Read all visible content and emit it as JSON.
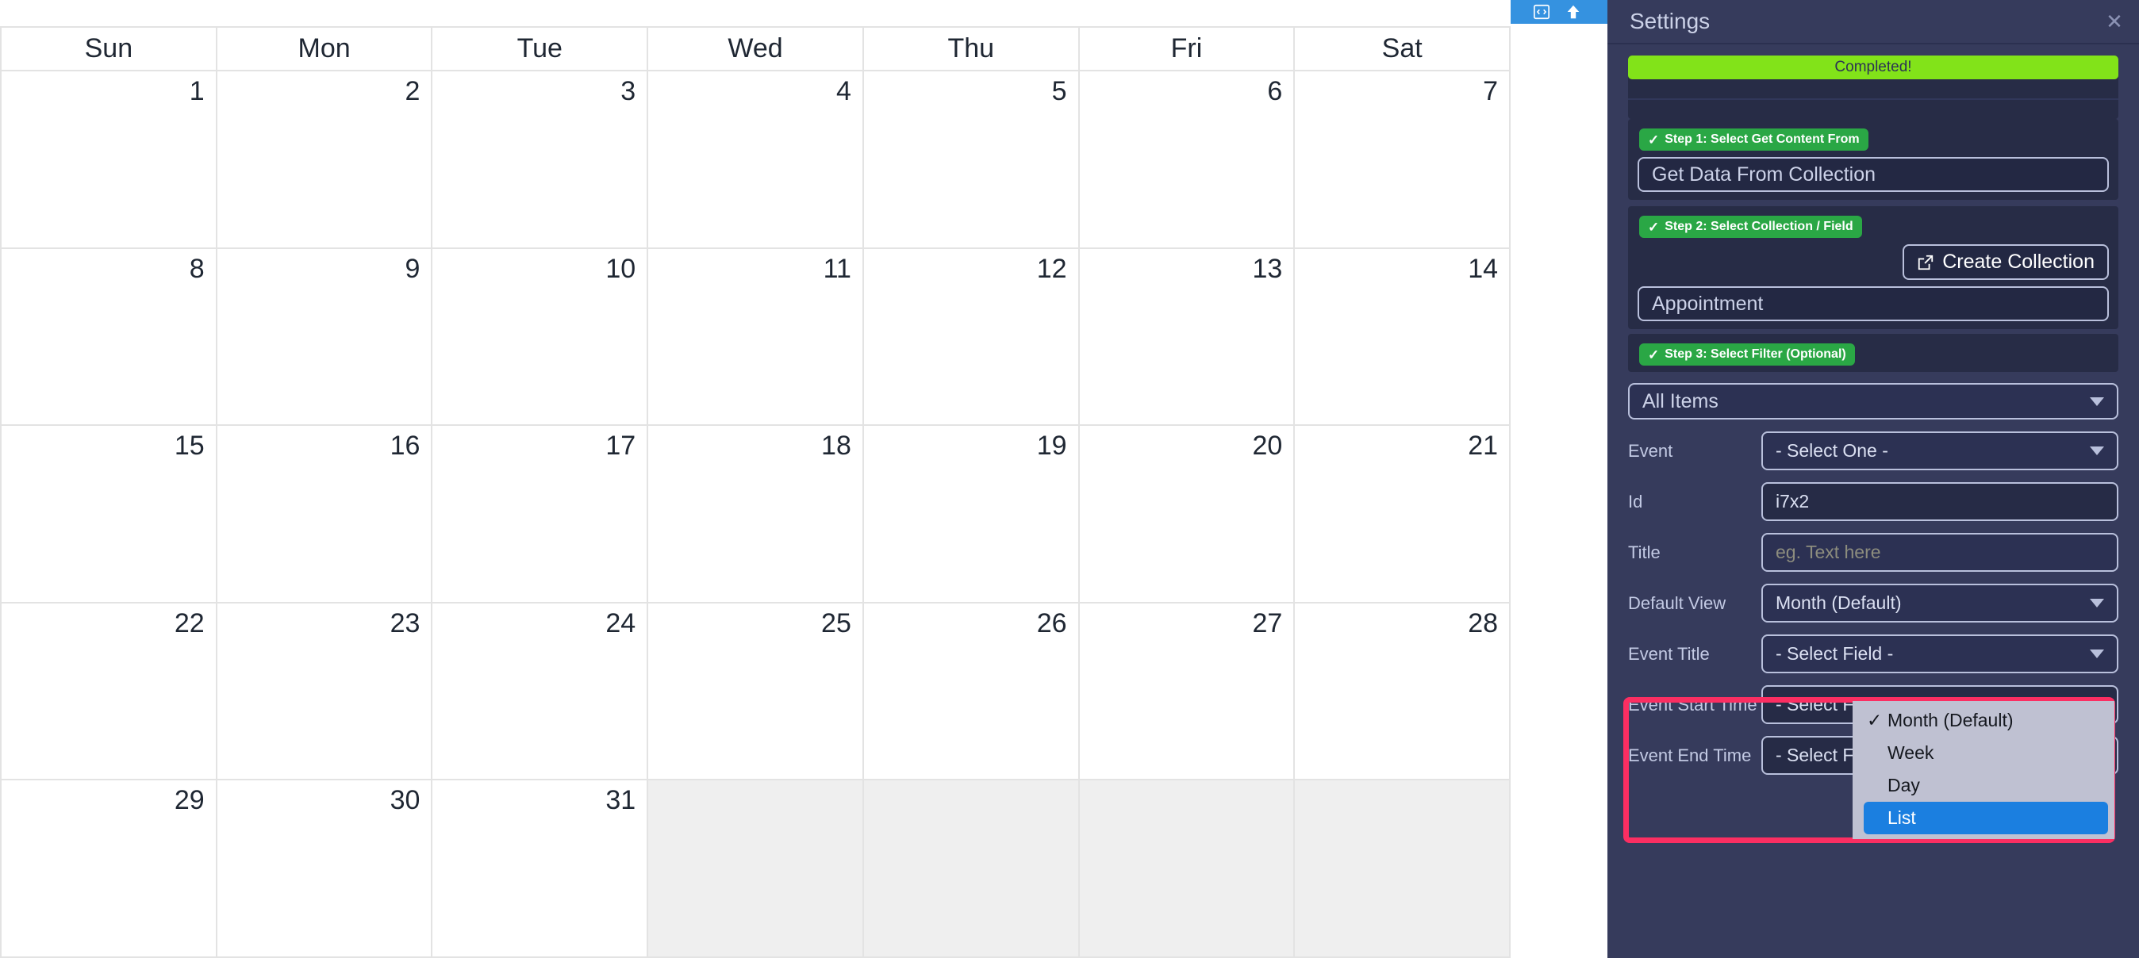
{
  "calendar": {
    "weekdays": [
      "Sun",
      "Mon",
      "Tue",
      "Wed",
      "Thu",
      "Fri",
      "Sat"
    ],
    "weeks": [
      [
        {
          "day": "1",
          "other": false
        },
        {
          "day": "2",
          "other": false
        },
        {
          "day": "3",
          "other": false
        },
        {
          "day": "4",
          "other": false
        },
        {
          "day": "5",
          "other": false
        },
        {
          "day": "6",
          "other": false
        },
        {
          "day": "7",
          "other": false
        }
      ],
      [
        {
          "day": "8",
          "other": false
        },
        {
          "day": "9",
          "other": false
        },
        {
          "day": "10",
          "other": false
        },
        {
          "day": "11",
          "other": false
        },
        {
          "day": "12",
          "other": false
        },
        {
          "day": "13",
          "other": false
        },
        {
          "day": "14",
          "other": false
        }
      ],
      [
        {
          "day": "15",
          "other": false
        },
        {
          "day": "16",
          "other": false
        },
        {
          "day": "17",
          "other": false
        },
        {
          "day": "18",
          "other": false
        },
        {
          "day": "19",
          "other": false
        },
        {
          "day": "20",
          "other": false
        },
        {
          "day": "21",
          "other": false
        }
      ],
      [
        {
          "day": "22",
          "other": false
        },
        {
          "day": "23",
          "other": false
        },
        {
          "day": "24",
          "other": false
        },
        {
          "day": "25",
          "other": false
        },
        {
          "day": "26",
          "other": false
        },
        {
          "day": "27",
          "other": false
        },
        {
          "day": "28",
          "other": false
        }
      ],
      [
        {
          "day": "29",
          "other": false
        },
        {
          "day": "30",
          "other": false
        },
        {
          "day": "31",
          "other": false
        },
        {
          "day": "",
          "other": true
        },
        {
          "day": "",
          "other": true
        },
        {
          "day": "",
          "other": true
        },
        {
          "day": "",
          "other": true
        }
      ]
    ]
  },
  "toolbar": {
    "code_icon": "code-icon",
    "up_icon": "arrow-up-icon"
  },
  "panel": {
    "title": "Settings",
    "close_label": "✕",
    "status": {
      "label": "Completed!",
      "color": "#82e319"
    },
    "steps": [
      {
        "check": "✓",
        "label": "Step 1: Select Get Content From"
      },
      {
        "check": "✓",
        "label": "Step 2: Select Collection / Field"
      },
      {
        "check": "✓",
        "label": "Step 3: Select Filter (Optional)"
      }
    ],
    "content_source": "Get Data From Collection",
    "create_collection_label": "Create Collection",
    "collection": "Appointment",
    "filter": "All Items",
    "fields": [
      {
        "label": "Event",
        "type": "select",
        "value": "- Select One -",
        "dark": false
      },
      {
        "label": "Id",
        "type": "text",
        "value": "i7x2",
        "placeholder": "",
        "filled": true
      },
      {
        "label": "Title",
        "type": "text",
        "value": "",
        "placeholder": "eg. Text here",
        "filled": false
      },
      {
        "label": "Default View",
        "type": "select",
        "value": "Month (Default)",
        "dark": false
      },
      {
        "label": "Event Title",
        "type": "select",
        "value": "- Select Field -",
        "dark": false
      },
      {
        "label": "Event Start Time",
        "type": "select",
        "value": "- Select Field -",
        "dark": true
      },
      {
        "label": "Event End Time",
        "type": "select",
        "value": "- Select Field -",
        "dark": true
      }
    ],
    "dropdown": {
      "open_for": "Default View",
      "options": [
        {
          "label": "Month (Default)",
          "checked": true,
          "selected": false
        },
        {
          "label": "Week",
          "checked": false,
          "selected": false
        },
        {
          "label": "Day",
          "checked": false,
          "selected": false
        },
        {
          "label": "List",
          "checked": false,
          "selected": true
        }
      ],
      "check_glyph": "✓"
    },
    "highlight_color": "#fb2e62"
  }
}
